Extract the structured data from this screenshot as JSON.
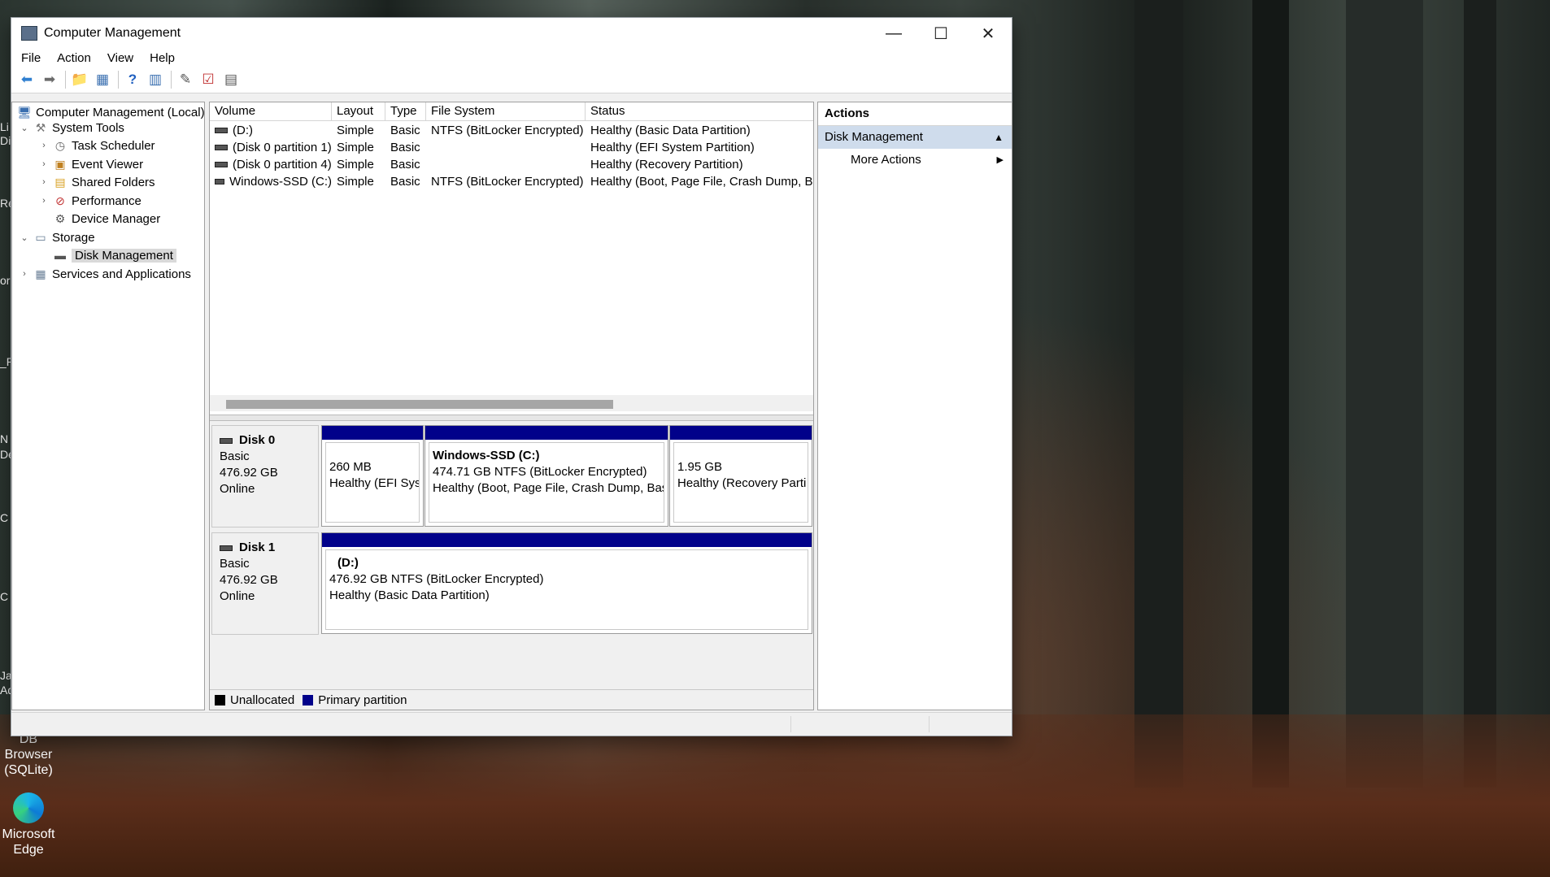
{
  "desktop": {
    "icons": [
      {
        "label": "DB Browser (SQLite)",
        "icon": "db-browser-icon"
      },
      {
        "label": "Microsoft Edge",
        "icon": "edge-icon"
      }
    ],
    "edge_fragments": [
      "Li",
      "Di",
      "Re",
      "or",
      "_P",
      "N",
      "De",
      "C",
      "C",
      "Ja",
      "Ad"
    ]
  },
  "window": {
    "title": "Computer Management",
    "controls": {
      "minimize": "—",
      "maximize": "☐",
      "close": "✕"
    }
  },
  "menu": [
    "File",
    "Action",
    "View",
    "Help"
  ],
  "toolbar": [
    {
      "name": "back-icon",
      "glyph": "⬅",
      "color": "#2f7fd0"
    },
    {
      "name": "forward-icon",
      "glyph": "➡",
      "color": "#6b6b6b"
    },
    {
      "name": "up-folder-icon",
      "glyph": "📁",
      "color": "#d8a020"
    },
    {
      "name": "show-hide-tree-icon",
      "glyph": "▦",
      "color": "#3a6fb0"
    },
    {
      "name": "help-icon",
      "glyph": "?",
      "color": "#2060c0"
    },
    {
      "name": "show-hide-action-pane-icon",
      "glyph": "▥",
      "color": "#3a6fb0"
    },
    {
      "name": "comment-icon",
      "glyph": "✎",
      "color": "#555"
    },
    {
      "name": "checklist-icon",
      "glyph": "☑",
      "color": "#c03030"
    },
    {
      "name": "properties-icon",
      "glyph": "▤",
      "color": "#555"
    }
  ],
  "tree": {
    "root": "Computer Management (Local)",
    "system_tools": "System Tools",
    "task_scheduler": "Task Scheduler",
    "event_viewer": "Event Viewer",
    "shared_folders": "Shared Folders",
    "performance": "Performance",
    "device_manager": "Device Manager",
    "storage": "Storage",
    "disk_management": "Disk Management",
    "services": "Services and Applications"
  },
  "volume_table": {
    "columns": [
      "Volume",
      "Layout",
      "Type",
      "File System",
      "Status"
    ],
    "rows": [
      [
        "(D:)",
        "Simple",
        "Basic",
        "NTFS (BitLocker Encrypted)",
        "Healthy (Basic Data Partition)"
      ],
      [
        "(Disk 0 partition 1)",
        "Simple",
        "Basic",
        "",
        "Healthy (EFI System Partition)"
      ],
      [
        "(Disk 0 partition 4)",
        "Simple",
        "Basic",
        "",
        "Healthy (Recovery Partition)"
      ],
      [
        "Windows-SSD (C:)",
        "Simple",
        "Basic",
        "NTFS (BitLocker Encrypted)",
        "Healthy (Boot, Page File, Crash Dump, Bas"
      ]
    ]
  },
  "disks": {
    "disk0": {
      "name": "Disk 0",
      "type": "Basic",
      "size": "476.92 GB",
      "state": "Online",
      "p1": {
        "size": "260 MB",
        "status": "Healthy (EFI Syst"
      },
      "p2": {
        "name": "Windows-SSD  (C:)",
        "size": "474.71 GB NTFS (BitLocker Encrypted)",
        "status": "Healthy (Boot, Page File, Crash Dump, Bas"
      },
      "p3": {
        "size": "1.95 GB",
        "status": "Healthy (Recovery Parti"
      }
    },
    "disk1": {
      "name": "Disk 1",
      "type": "Basic",
      "size": "476.92 GB",
      "state": "Online",
      "p1": {
        "name": "(D:)",
        "size": "476.92 GB NTFS (BitLocker Encrypted)",
        "status": "Healthy (Basic Data Partition)"
      }
    }
  },
  "legend": {
    "unallocated": "Unallocated",
    "unallocated_color": "#000000",
    "primary": "Primary partition",
    "primary_color": "#01018a"
  },
  "actions": {
    "header": "Actions",
    "section": "Disk Management",
    "more": "More Actions"
  }
}
